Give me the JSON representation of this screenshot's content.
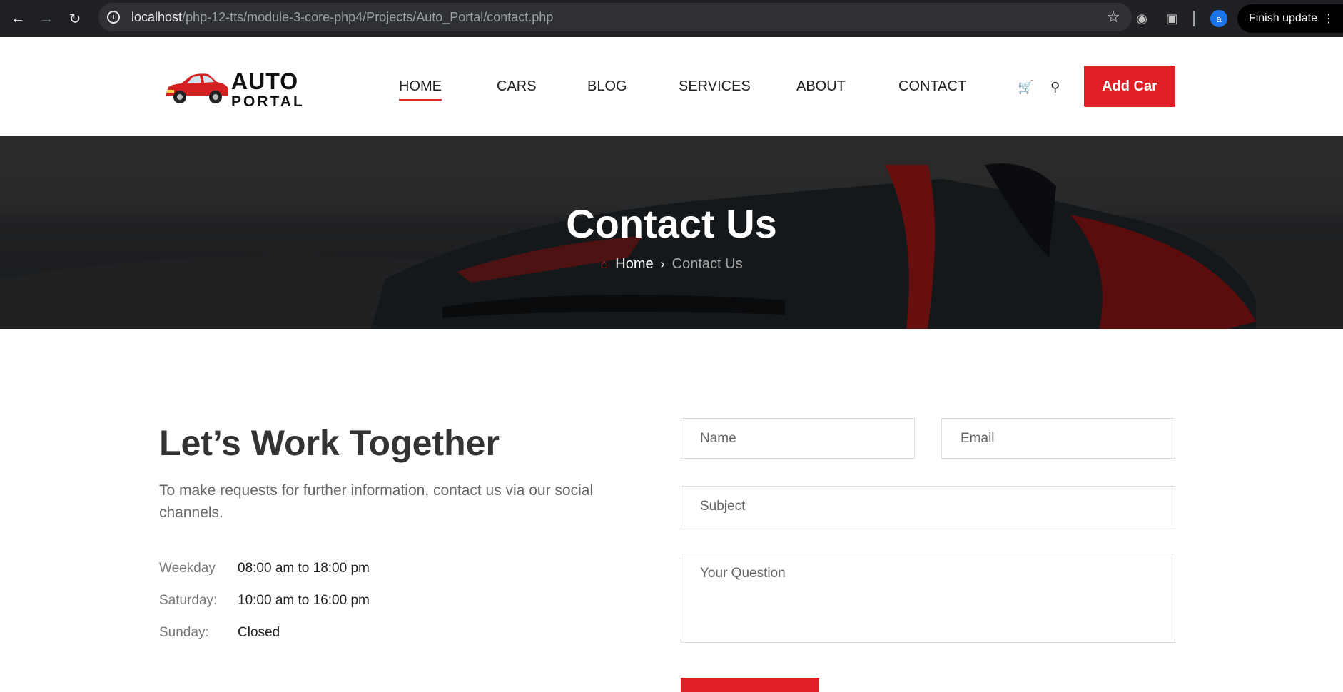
{
  "browser": {
    "url_host": "localhost",
    "url_path": "/php-12-tts/module-3-core-php4/Projects/Auto_Portal/contact.php",
    "profile_initial": "a",
    "finish_update_label": "Finish update"
  },
  "header": {
    "logo_line1": "AUTO",
    "logo_line2": "PORTAL",
    "nav": [
      "HOME",
      "CARS",
      "BLOG",
      "SERVICES",
      "ABOUT",
      "CONTACT"
    ],
    "active_nav": "HOME",
    "add_car_label": "Add Car"
  },
  "hero": {
    "title": "Contact Us",
    "breadcrumb_home": "Home",
    "breadcrumb_current": "Contact Us"
  },
  "contact": {
    "heading": "Let’s Work Together",
    "intro": "To make requests for further information, contact us via our social channels.",
    "hours": [
      {
        "day": "Weekday",
        "time": "08:00 am to 18:00 pm"
      },
      {
        "day": "Saturday:",
        "time": "10:00 am to 16:00 pm"
      },
      {
        "day": "Sunday:",
        "time": "Closed"
      }
    ]
  },
  "form": {
    "name_placeholder": "Name",
    "email_placeholder": "Email",
    "subject_placeholder": "Subject",
    "question_placeholder": "Your Question"
  },
  "colors": {
    "accent": "#e11f26",
    "chrome_bg": "#202124",
    "text_dark": "#333333"
  }
}
